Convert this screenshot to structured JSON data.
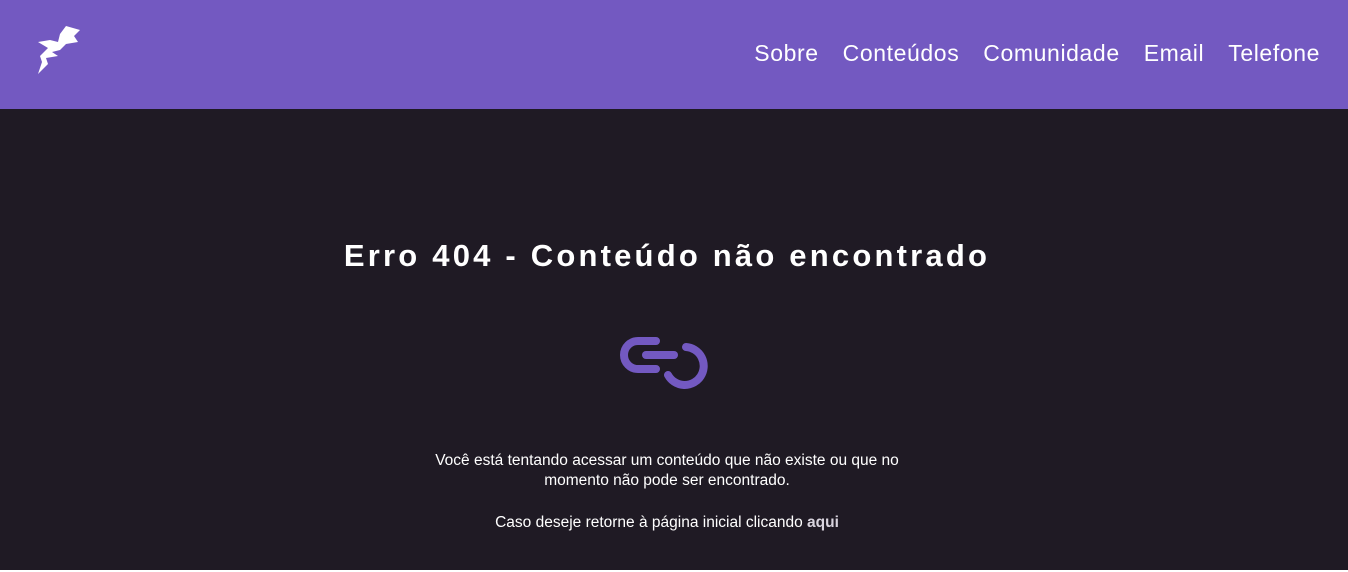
{
  "header": {
    "nav": [
      {
        "label": "Sobre"
      },
      {
        "label": "Conteúdos"
      },
      {
        "label": "Comunidade"
      },
      {
        "label": "Email"
      },
      {
        "label": "Telefone"
      }
    ]
  },
  "main": {
    "title": "Erro 404 - Conteúdo não encontrado",
    "message_line1": "Você está tentando acessar um conteúdo que não existe ou que no momento não pode ser encontrado.",
    "message_line2_prefix": "Caso deseje retorne à página inicial clicando ",
    "home_link": "aqui"
  },
  "icons": {
    "logo": "bird-logo-icon",
    "broken_link": "broken-link-icon"
  },
  "colors": {
    "accent": "#7359c1",
    "background": "#1f1a24",
    "text": "#ffffff"
  }
}
